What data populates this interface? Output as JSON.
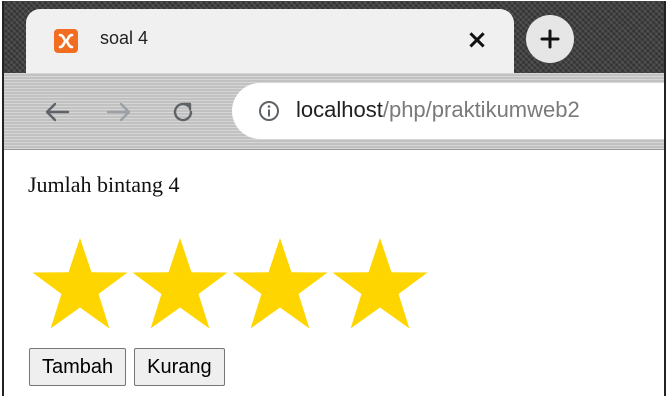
{
  "browser": {
    "tab": {
      "title": "soal 4",
      "favicon": "xampp-icon",
      "close_glyph": "×"
    },
    "new_tab_glyph": "+",
    "toolbar": {
      "back": "back-arrow-icon",
      "forward": "forward-arrow-icon",
      "reload": "reload-icon",
      "info": "info-icon"
    },
    "address": {
      "host": "localhost",
      "path": "/php/praktikumweb2"
    }
  },
  "page": {
    "heading": "Jumlah bintang 4",
    "star_count": 4,
    "star_color": "#ffd500",
    "buttons": {
      "add_label": "Tambah",
      "remove_label": "Kurang"
    }
  },
  "colors": {
    "favicon": "#f26d21",
    "tab_background": "#f0f0f0",
    "url_host": "#202020",
    "url_path": "#7a7a7a"
  }
}
